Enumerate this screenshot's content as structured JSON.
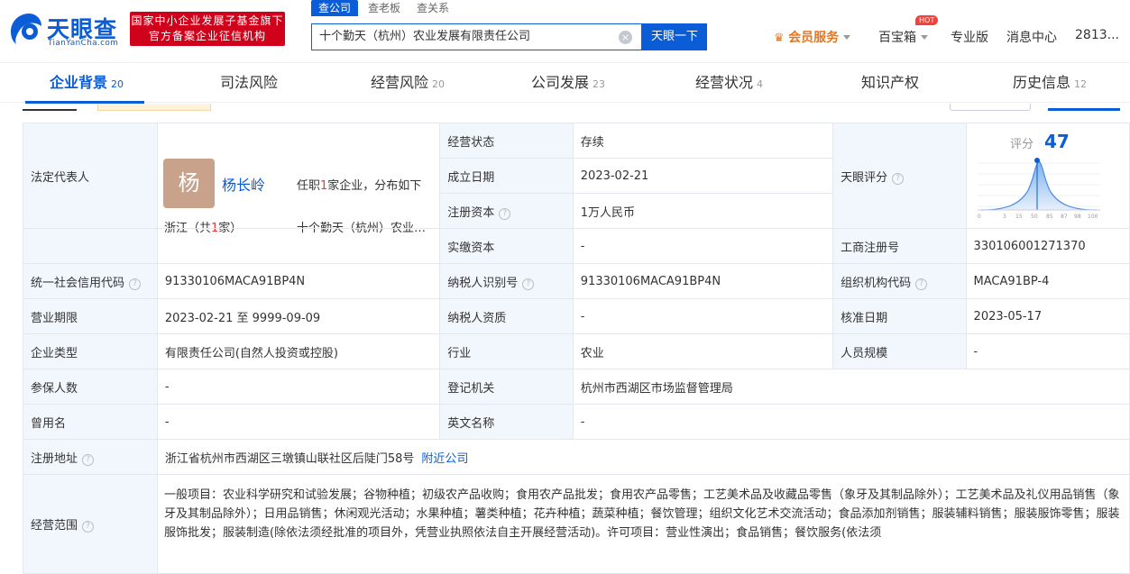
{
  "header": {
    "logo_text": "天眼查",
    "logo_sub": "TianYanCha.com",
    "badge_line1": "国家中小企业发展子基金旗下",
    "badge_line2": "官方备案企业征信机构",
    "search_tabs": [
      "查公司",
      "查老板",
      "查关系"
    ],
    "search_value": "十个勤天（杭州）农业发展有限责任公司",
    "search_button": "天眼一下",
    "vip": "会员服务",
    "treasure": "百宝箱",
    "hot": "HOT",
    "pro": "专业版",
    "messages": "消息中心",
    "user": "2813..."
  },
  "tabs": [
    {
      "label": "企业背景",
      "count": "20"
    },
    {
      "label": "司法风险",
      "count": ""
    },
    {
      "label": "经营风险",
      "count": "20"
    },
    {
      "label": "公司发展",
      "count": "23"
    },
    {
      "label": "经营状况",
      "count": "4"
    },
    {
      "label": "知识产权",
      "count": ""
    },
    {
      "label": "历史信息",
      "count": "12"
    }
  ],
  "rep": {
    "label": "法定代表人",
    "avatar": "杨",
    "name": "杨长岭",
    "info_pre": "任职",
    "info_num": "1",
    "info_post": "家企业，分布如下",
    "prov_pre": "浙江（共",
    "prov_num": "1",
    "prov_post": "家）",
    "company": "十个勤天（杭州）农业发展有限责任公司"
  },
  "rows": {
    "status_label": "经营状态",
    "status": "存续",
    "found_label": "成立日期",
    "found": "2023-02-21",
    "capital_label": "注册资本",
    "capital": "1万人民币",
    "paid_label": "实缴资本",
    "paid": "-",
    "score_label": "天眼评分",
    "score_word": "评分",
    "score_value": "47",
    "score_ticks": [
      "0",
      "3",
      "15",
      "50",
      "85",
      "87",
      "98",
      "100"
    ],
    "regno_label": "工商注册号",
    "regno": "330106001271370",
    "credit_label": "统一社会信用代码",
    "credit": "91330106MACA91BP4N",
    "taxid_label": "纳税人识别号",
    "taxid": "91330106MACA91BP4N",
    "org_label": "组织机构代码",
    "org": "MACA91BP-4",
    "period_label": "营业期限",
    "period": "2023-02-21 至 9999-09-09",
    "taxq_label": "纳税人资质",
    "taxq": "-",
    "approve_label": "核准日期",
    "approve": "2023-05-17",
    "type_label": "企业类型",
    "type": "有限责任公司(自然人投资或控股)",
    "industry_label": "行业",
    "industry": "农业",
    "staff_label": "人员规模",
    "staff": "-",
    "insured_label": "参保人数",
    "insured": "-",
    "authority_label": "登记机关",
    "authority": "杭州市西湖区市场监督管理局",
    "former_label": "曾用名",
    "former": "-",
    "en_label": "英文名称",
    "en": "-",
    "addr_label": "注册地址",
    "addr": "浙江省杭州市西湖区三墩镇山联社区后陡门58号",
    "nearby": "附近公司",
    "scope_label": "经营范围",
    "scope": "一般项目：农业科学研究和试验发展；谷物种植；初级农产品收购；食用农产品批发；食用农产品零售；工艺美术品及收藏品零售（象牙及其制品除外）；工艺美术品及礼仪用品销售（象牙及其制品除外）；日用品销售；休闲观光活动；水果种植；薯类种植；花卉种植；蔬菜种植；餐饮管理；组织文化艺术交流活动；食品添加剂销售；服装辅料销售；服装服饰零售；服装服饰批发；服装制造(除依法须经批准的项目外，凭营业执照依法自主开展经营活动)。许可项目：营业性演出；食品销售；餐饮服务(依法须"
  },
  "colors": {
    "accent": "#0a5dd6",
    "label_bg": "#f2f6fd",
    "red": "#d0021b"
  }
}
